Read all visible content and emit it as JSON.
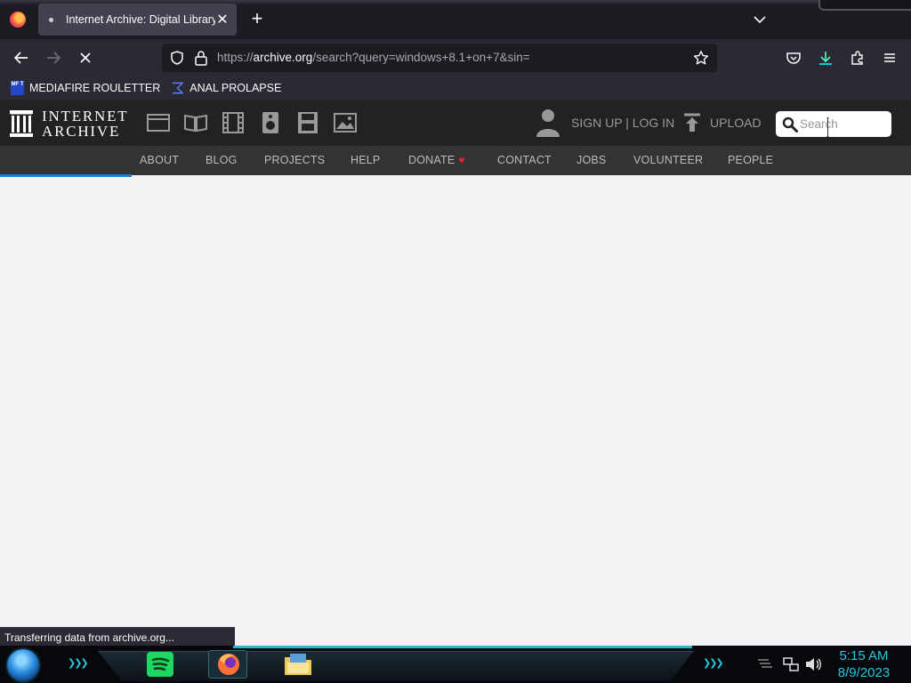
{
  "browser": {
    "tab_title": "Internet Archive: Digital Library",
    "tab_close": "✕",
    "new_tab": "+",
    "url_prefix": "https://",
    "url_host": "archive.org",
    "url_rest": "/search?query=windows+8.1+on+7&sin=",
    "bookmarks": [
      {
        "label": "MEDIAFIRE ROULETTER",
        "icon": "mediafire-icon",
        "badge": "MF T"
      },
      {
        "label": "ANAL PROLAPSE",
        "icon": "sigma-bookmark-icon"
      }
    ],
    "status_text": "Transferring data from archive.org...",
    "loading_progress_percent": 14.5
  },
  "archive": {
    "logo_line1": "INTERNET",
    "logo_line2": "ARCHIVE",
    "media_icons": [
      "web-icon",
      "texts-icon",
      "video-icon",
      "audio-icon",
      "software-icon",
      "images-icon"
    ],
    "signup_label": "SIGN UP | LOG IN",
    "upload_label": "UPLOAD",
    "search_placeholder": "Search",
    "nav": [
      "ABOUT",
      "BLOG",
      "PROJECTS",
      "HELP",
      "DONATE",
      "CONTACT",
      "JOBS",
      "VOLUNTEER",
      "PEOPLE"
    ],
    "donate_heart": "♥"
  },
  "taskbar": {
    "time": "5:15 AM",
    "date": "8/9/2023",
    "chevrons": "❯❯❯"
  },
  "colors": {
    "accent_blue": "#1d7ed8",
    "taskbar_cyan": "#27c7df",
    "heart_red": "#e8212a"
  }
}
